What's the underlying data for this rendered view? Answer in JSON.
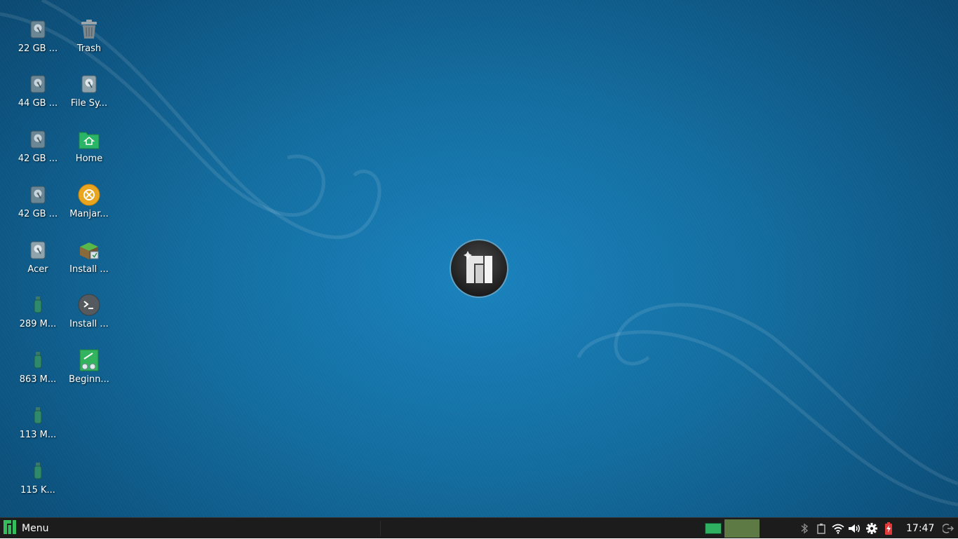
{
  "desktop": {
    "column1": [
      {
        "label": "22 GB ...",
        "icon": "hard-drive-icon"
      },
      {
        "label": "44 GB ...",
        "icon": "hard-drive-icon"
      },
      {
        "label": "42 GB ...",
        "icon": "hard-drive-icon"
      },
      {
        "label": "42 GB ...",
        "icon": "hard-drive-icon"
      },
      {
        "label": "Acer",
        "icon": "hard-drive-icon"
      },
      {
        "label": "289 M...",
        "icon": "usb-drive-icon"
      },
      {
        "label": "863 M...",
        "icon": "usb-drive-icon"
      },
      {
        "label": "113 M...",
        "icon": "usb-drive-icon"
      },
      {
        "label": "115 K...",
        "icon": "usb-drive-icon"
      }
    ],
    "column2": [
      {
        "label": "Trash",
        "icon": "trash-icon"
      },
      {
        "label": "File Sy...",
        "icon": "hard-drive-icon"
      },
      {
        "label": "Home",
        "icon": "home-folder-icon"
      },
      {
        "label": "Manjar...",
        "icon": "manjaro-welcome-icon"
      },
      {
        "label": "Install ...",
        "icon": "installer-box-icon"
      },
      {
        "label": "Install ...",
        "icon": "terminal-icon"
      },
      {
        "label": "Beginn...",
        "icon": "beginner-guide-icon"
      }
    ]
  },
  "taskbar": {
    "menu_label": "Menu",
    "clock": "17:47",
    "tray_icons": [
      "bluetooth-icon",
      "clipboard-icon",
      "wifi-icon",
      "volume-icon",
      "settings-icon",
      "battery-icon"
    ]
  },
  "colors": {
    "desktop_bg": "#136d9f",
    "taskbar_bg": "#1c1c1c",
    "accent_green": "#2eb060",
    "workspace_active": "#5e7a44",
    "battery_red": "#e03a3a"
  }
}
